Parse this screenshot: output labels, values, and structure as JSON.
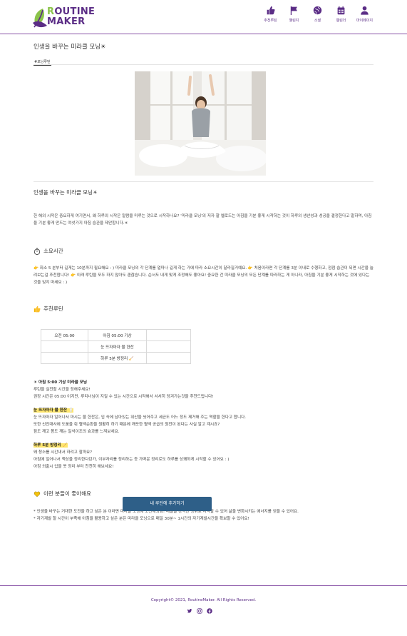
{
  "header": {
    "logo_line1": "OUTINE",
    "logo_r": "R",
    "logo_line2": "MAKER",
    "nav": [
      {
        "label": "추천루틴",
        "icon": "thumbs-up-icon"
      },
      {
        "label": "챌린지",
        "icon": "flag-icon"
      },
      {
        "label": "소셜",
        "icon": "globe-icon"
      },
      {
        "label": "캘린더",
        "icon": "calendar-icon"
      },
      {
        "label": "마이페이지",
        "icon": "user-icon"
      }
    ]
  },
  "post": {
    "title": "인생을 바꾸는 미라클 모닝☀",
    "hashtag": "#모닝루틴",
    "image_alt": "woman stretching in bed",
    "subtitle": "인생을 바꾸는 미라클 모닝☀",
    "intro": "한 해의 시작은 중요하게 여기면서, 왜 하루의 시작은 알람을 미루는 것으로 시작하나요? '미라클 모닝'의 저자 할 엘로드는 아침을 기분 좋게 시작하는 것이 하루의 생산성과 성공을 결정한다고 말하며, 아침을 기분 좋게 만드는 여섯가지 아침 습관을 제안합니다.☀",
    "time_section_title": "소요시간",
    "time_text": "👉 최소 5 분부터 길게는 10분까지 필요해요 : ) 미라클 모닝의 각 단계를 얼마나 길게 하는 가에 따라 소요시간이 달라질거예요. 👉 처음이라면 각 단계를 3분 이내로 수행하고, 점점 습관이 되면 시간을 늘려보는걸 추천합니다! 👉 이래 루틴을 모두 하지 않아도 괜찮습니다. 순서도 내게 맞게 조정해도 좋아요! 중요한 건 미라클 모닝의 모든 단계를 따라하는 게 아니라, 아침을 기분 좋게 시작하는 것에 있다는 것을 잊지 마세요 : )",
    "routine_section_title": "추천루틴",
    "table": [
      [
        "오전 05:00",
        "아침 05:00 기상",
        ""
      ],
      [
        "",
        "눈 뜨자마자 물 한잔",
        ""
      ],
      [
        "",
        "하루 5분 방정리 🧹",
        ""
      ]
    ],
    "blocks": [
      {
        "title": "☀ 아침 5:00 기상 미라클 모닝",
        "lines": [
          "루틴을 실천할 시간을 정해주세요!",
          "권장 시간은 05:00 이지만, 루티너님이 지킬 수 있는 시간으로 시작해서 서서히 당겨가는것을 추천드립니다!"
        ]
      },
      {
        "title": "눈 뜨자마자 물 한잔 🥛",
        "lines": [
          "눈 뜨자마자 일어나서 마시는 물 한잔은, 입 속에 남아있는 위산을 씻어주고 세균도 어느 정도 제거해 주는 역할을 한다고 합니다.",
          "또한 신진대사에 도움을 줘 혈액순환을 원활히 하기 때문에 깨끗한 혈액 공급의 원천이 된다는 사실 알고 계시죠?",
          "잠도 깨고 몸도 깨는 일석이조의 효과를 느껴보세요."
        ]
      },
      {
        "title": "하루 5분 방정리 🧹",
        "lines": [
          "왜 청소를 시간내서 하려고 할까요?",
          "아침에 일어나서 책상을 정리한다던가, 이부자리를 정리하는 등 가벼운 정리로도 하루를 상쾌하게 시작할 수 있어요 : )",
          "아침 외출시 입을 옷 정리 부터 천천히 해보세요!"
        ]
      }
    ],
    "audience_title": "이런 분들이 좋아해요",
    "audience": [
      "* 인생을 바꾸는 거대한 도전을 하고 싶은 분 이라면 미라클 모닝에 도전해봐요! 매일을 강력한 성취로 시작할 수 있어 삶을 변화시키는 에너지를 얻을 수 있어요.",
      "* 자기계발 할 시간이 부족해 아침을 활용하고 싶은 분은 미라클 모닝으로 매일 30분~ 1시간의 자기계발시간을 확보할 수 있어요!"
    ],
    "cta_label": "내 루틴에 추가하기"
  },
  "footer": {
    "copyright": "Copyright© 2021, RoutineMaker. All Rights Reserved.",
    "social": [
      "twitter-icon",
      "instagram-icon",
      "facebook-icon"
    ]
  },
  "colors": {
    "brand": "#5b2d86",
    "accent": "#8bc34a",
    "cta": "#2e5f88"
  }
}
